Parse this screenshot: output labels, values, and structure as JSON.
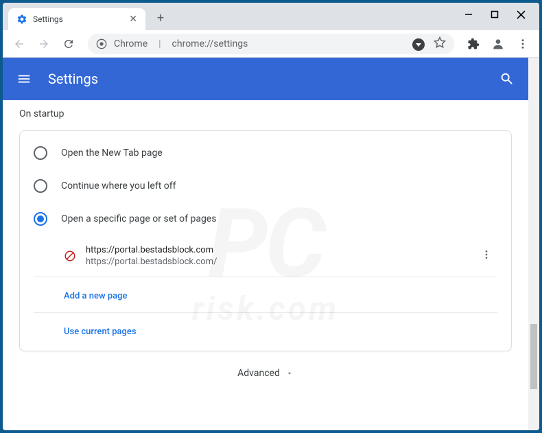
{
  "tab": {
    "title": "Settings"
  },
  "omnibox": {
    "origin": "Chrome",
    "url": "chrome://settings"
  },
  "header": {
    "title": "Settings"
  },
  "section": {
    "title": "On startup"
  },
  "options": {
    "newtab": "Open the New Tab page",
    "continue": "Continue where you left off",
    "specific": "Open a specific page or set of pages"
  },
  "page_entry": {
    "title": "https://portal.bestadsblock.com",
    "url": "https://portal.bestadsblock.com/"
  },
  "links": {
    "add": "Add a new page",
    "use_current": "Use current pages"
  },
  "advanced": {
    "label": "Advanced"
  },
  "watermark": {
    "main": "PC",
    "sub": "risk.com"
  }
}
